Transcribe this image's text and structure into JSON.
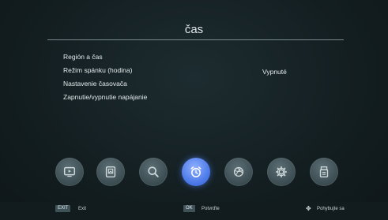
{
  "title": "čas",
  "menu": {
    "items": [
      {
        "label": "Región a čas"
      },
      {
        "label": "Režim spánku (hodina)"
      },
      {
        "label": "Nastavenie časovača"
      },
      {
        "label": "Zapnutie/vypnutie napájanie"
      }
    ],
    "sleep_value": "Vypnuté"
  },
  "icons": [
    {
      "name": "tv-icon",
      "active": false
    },
    {
      "name": "picture-icon",
      "active": false
    },
    {
      "name": "search-icon",
      "active": false
    },
    {
      "name": "alarm-clock-icon",
      "active": true
    },
    {
      "name": "globe-icon",
      "active": false
    },
    {
      "name": "gear-icon",
      "active": false
    },
    {
      "name": "usb-icon",
      "active": false
    }
  ],
  "footer": {
    "exit_key": "EXIT",
    "exit_label": "Exit",
    "ok_key": "OK",
    "ok_label": "Potvrďte",
    "move_label": "Pohybujte sa"
  },
  "colors": {
    "background": "#152125",
    "accent": "#4a78e8",
    "text": "#e2eaec"
  }
}
